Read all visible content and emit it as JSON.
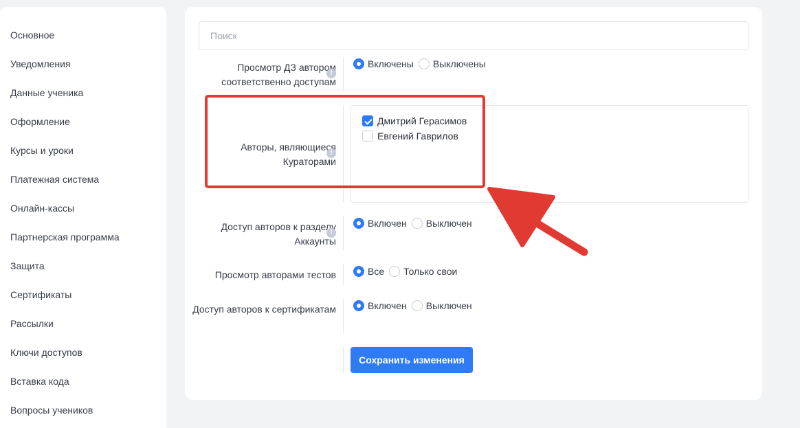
{
  "sidebar": {
    "items": [
      {
        "label": "Основное"
      },
      {
        "label": "Уведомления"
      },
      {
        "label": "Данные ученика"
      },
      {
        "label": "Оформление"
      },
      {
        "label": "Курсы и уроки"
      },
      {
        "label": "Платежная система"
      },
      {
        "label": "Онлайн-кассы"
      },
      {
        "label": "Партнерская программа"
      },
      {
        "label": "Защита"
      },
      {
        "label": "Сертификаты"
      },
      {
        "label": "Рассылки"
      },
      {
        "label": "Ключи доступов"
      },
      {
        "label": "Вставка кода"
      },
      {
        "label": "Вопросы учеников"
      }
    ]
  },
  "search": {
    "placeholder": "Поиск",
    "value": ""
  },
  "settings": {
    "hw_view": {
      "label": "Просмотр ДЗ автором соответственно доступам",
      "options": [
        "Включены",
        "Выключены"
      ],
      "selected": "Включены"
    },
    "curators": {
      "label": "Авторы, являющиеся Кураторами",
      "authors": [
        {
          "name": "Дмитрий Герасимов",
          "checked": true
        },
        {
          "name": "Евгений Гаврилов",
          "checked": false
        }
      ]
    },
    "accounts_access": {
      "label": "Доступ авторов к разделу Аккаунты",
      "options": [
        "Включен",
        "Выключен"
      ],
      "selected": "Включен"
    },
    "tests_view": {
      "label": "Просмотр авторами тестов",
      "options": [
        "Все",
        "Только свои"
      ],
      "selected": "Все"
    },
    "certificates_access": {
      "label": "Доступ авторов к сертификатам",
      "options": [
        "Включен",
        "Выключен"
      ],
      "selected": "Включен"
    }
  },
  "save_button": {
    "label": "Сохранить изменения"
  },
  "info_icon": {
    "glyph": "!"
  },
  "colors": {
    "accent": "#2f7af5",
    "annotation": "#e13a32"
  }
}
